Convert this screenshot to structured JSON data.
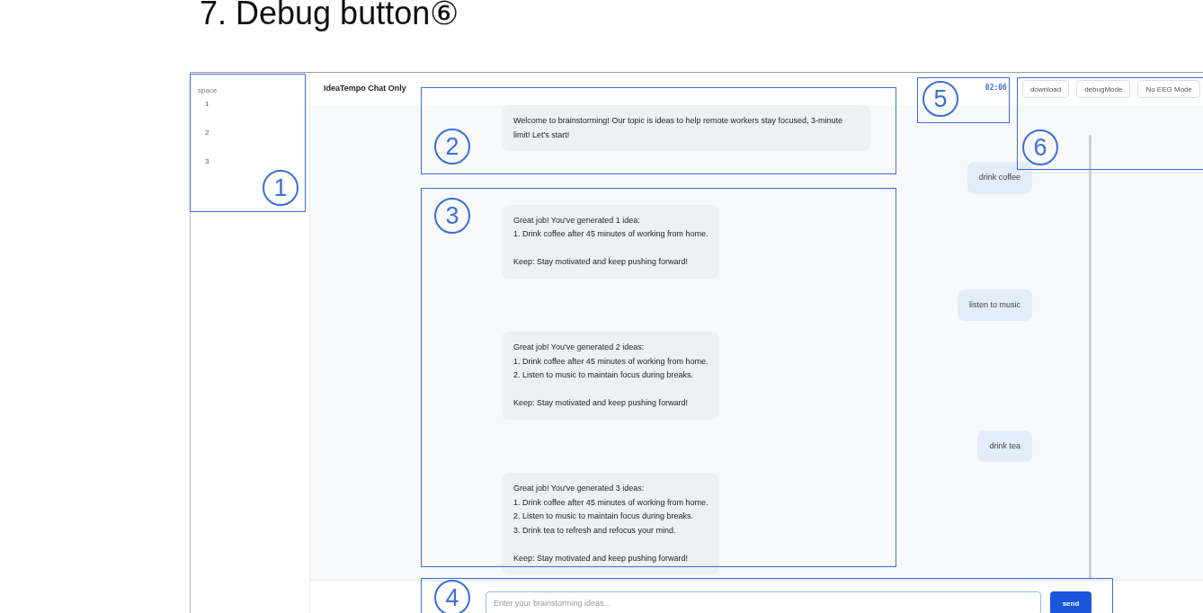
{
  "heading": "7. Debug button⑥",
  "app": {
    "sidebar": {
      "title": "space",
      "items": [
        "1",
        "2",
        "3"
      ]
    },
    "title": "IdeaTempo Chat Only",
    "timer": "02:06",
    "buttons": [
      "download",
      "debugMode",
      "No EEG Mode"
    ],
    "messages": [
      {
        "kind": "bot",
        "text": "Welcome to brainstorming! Our topic is ideas to help remote workers stay focused, 3-minute limit! Let's start!"
      },
      {
        "kind": "user",
        "text": "drink coffee"
      },
      {
        "kind": "bot",
        "text": "Great job! You've generated 1 idea:\n1. Drink coffee after 45 minutes of working from home.\n\nKeep: Stay motivated and keep pushing forward!"
      },
      {
        "kind": "user",
        "text": "listen to music"
      },
      {
        "kind": "bot",
        "text": "Great job! You've generated 2 ideas:\n1. Drink coffee after 45 minutes of working from home.\n2. Listen to music to maintain focus during breaks.\n\nKeep: Stay motivated and keep pushing forward!"
      },
      {
        "kind": "user",
        "text": "drink tea"
      },
      {
        "kind": "bot",
        "text": "Great job! You've generated 3 ideas:\n1. Drink coffee after 45 minutes of working from home.\n2. Listen to music to maintain focus during breaks.\n3. Drink tea to refresh and refocus your mind.\n\nKeep: Stay motivated and keep pushing forward!"
      }
    ],
    "input": {
      "placeholder": "Enter your brainstorming ideas..."
    },
    "send_button": "send"
  },
  "annotations": [
    {
      "number": "1"
    },
    {
      "number": "2"
    },
    {
      "number": "3"
    },
    {
      "number": "4"
    },
    {
      "number": "5"
    },
    {
      "number": "6"
    }
  ]
}
